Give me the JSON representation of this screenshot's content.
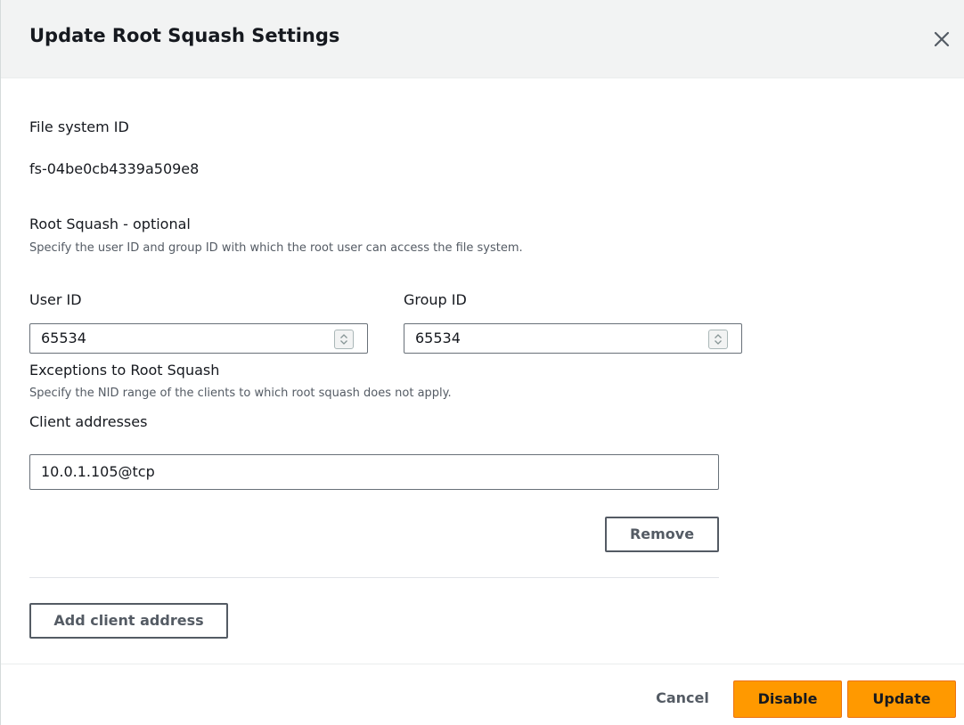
{
  "modal": {
    "title": "Update Root Squash Settings"
  },
  "file_system": {
    "label": "File system ID",
    "value": "fs-04be0cb4339a509e8"
  },
  "root_squash": {
    "label": "Root Squash - optional",
    "description": "Specify the user ID and group ID with which the root user can access the file system.",
    "user_id_label": "User ID",
    "user_id_value": "65534",
    "group_id_label": "Group ID",
    "group_id_value": "65534"
  },
  "exceptions": {
    "label": "Exceptions to Root Squash",
    "description": "Specify the NID range of the clients to which root squash does not apply.",
    "client_addresses_label": "Client addresses",
    "client_address_value": "10.0.1.105@tcp",
    "remove_label": "Remove",
    "add_label": "Add client address"
  },
  "footer": {
    "cancel_label": "Cancel",
    "disable_label": "Disable",
    "update_label": "Update"
  },
  "colors": {
    "primary": "#ff9900",
    "header_bg": "#f2f3f3",
    "text": "#16191f",
    "secondary_text": "#545b64"
  },
  "icons": {
    "close": "close-icon",
    "stepper": "stepper-icon"
  }
}
